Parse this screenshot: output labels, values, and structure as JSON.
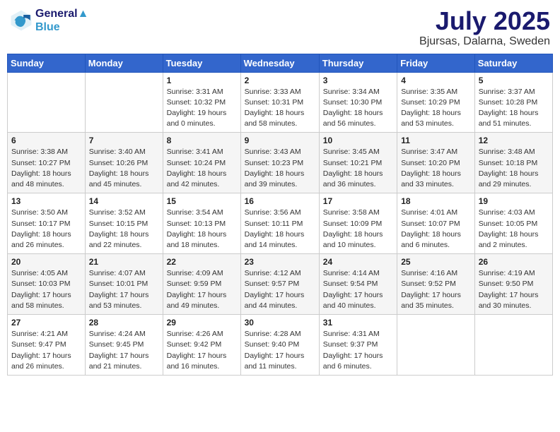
{
  "header": {
    "logo_line1": "General",
    "logo_line2": "Blue",
    "month": "July 2025",
    "location": "Bjursas, Dalarna, Sweden"
  },
  "weekdays": [
    "Sunday",
    "Monday",
    "Tuesday",
    "Wednesday",
    "Thursday",
    "Friday",
    "Saturday"
  ],
  "weeks": [
    [
      {
        "day": "",
        "content": ""
      },
      {
        "day": "",
        "content": ""
      },
      {
        "day": "1",
        "content": "Sunrise: 3:31 AM\nSunset: 10:32 PM\nDaylight: 19 hours\nand 0 minutes."
      },
      {
        "day": "2",
        "content": "Sunrise: 3:33 AM\nSunset: 10:31 PM\nDaylight: 18 hours\nand 58 minutes."
      },
      {
        "day": "3",
        "content": "Sunrise: 3:34 AM\nSunset: 10:30 PM\nDaylight: 18 hours\nand 56 minutes."
      },
      {
        "day": "4",
        "content": "Sunrise: 3:35 AM\nSunset: 10:29 PM\nDaylight: 18 hours\nand 53 minutes."
      },
      {
        "day": "5",
        "content": "Sunrise: 3:37 AM\nSunset: 10:28 PM\nDaylight: 18 hours\nand 51 minutes."
      }
    ],
    [
      {
        "day": "6",
        "content": "Sunrise: 3:38 AM\nSunset: 10:27 PM\nDaylight: 18 hours\nand 48 minutes."
      },
      {
        "day": "7",
        "content": "Sunrise: 3:40 AM\nSunset: 10:26 PM\nDaylight: 18 hours\nand 45 minutes."
      },
      {
        "day": "8",
        "content": "Sunrise: 3:41 AM\nSunset: 10:24 PM\nDaylight: 18 hours\nand 42 minutes."
      },
      {
        "day": "9",
        "content": "Sunrise: 3:43 AM\nSunset: 10:23 PM\nDaylight: 18 hours\nand 39 minutes."
      },
      {
        "day": "10",
        "content": "Sunrise: 3:45 AM\nSunset: 10:21 PM\nDaylight: 18 hours\nand 36 minutes."
      },
      {
        "day": "11",
        "content": "Sunrise: 3:47 AM\nSunset: 10:20 PM\nDaylight: 18 hours\nand 33 minutes."
      },
      {
        "day": "12",
        "content": "Sunrise: 3:48 AM\nSunset: 10:18 PM\nDaylight: 18 hours\nand 29 minutes."
      }
    ],
    [
      {
        "day": "13",
        "content": "Sunrise: 3:50 AM\nSunset: 10:17 PM\nDaylight: 18 hours\nand 26 minutes."
      },
      {
        "day": "14",
        "content": "Sunrise: 3:52 AM\nSunset: 10:15 PM\nDaylight: 18 hours\nand 22 minutes."
      },
      {
        "day": "15",
        "content": "Sunrise: 3:54 AM\nSunset: 10:13 PM\nDaylight: 18 hours\nand 18 minutes."
      },
      {
        "day": "16",
        "content": "Sunrise: 3:56 AM\nSunset: 10:11 PM\nDaylight: 18 hours\nand 14 minutes."
      },
      {
        "day": "17",
        "content": "Sunrise: 3:58 AM\nSunset: 10:09 PM\nDaylight: 18 hours\nand 10 minutes."
      },
      {
        "day": "18",
        "content": "Sunrise: 4:01 AM\nSunset: 10:07 PM\nDaylight: 18 hours\nand 6 minutes."
      },
      {
        "day": "19",
        "content": "Sunrise: 4:03 AM\nSunset: 10:05 PM\nDaylight: 18 hours\nand 2 minutes."
      }
    ],
    [
      {
        "day": "20",
        "content": "Sunrise: 4:05 AM\nSunset: 10:03 PM\nDaylight: 17 hours\nand 58 minutes."
      },
      {
        "day": "21",
        "content": "Sunrise: 4:07 AM\nSunset: 10:01 PM\nDaylight: 17 hours\nand 53 minutes."
      },
      {
        "day": "22",
        "content": "Sunrise: 4:09 AM\nSunset: 9:59 PM\nDaylight: 17 hours\nand 49 minutes."
      },
      {
        "day": "23",
        "content": "Sunrise: 4:12 AM\nSunset: 9:57 PM\nDaylight: 17 hours\nand 44 minutes."
      },
      {
        "day": "24",
        "content": "Sunrise: 4:14 AM\nSunset: 9:54 PM\nDaylight: 17 hours\nand 40 minutes."
      },
      {
        "day": "25",
        "content": "Sunrise: 4:16 AM\nSunset: 9:52 PM\nDaylight: 17 hours\nand 35 minutes."
      },
      {
        "day": "26",
        "content": "Sunrise: 4:19 AM\nSunset: 9:50 PM\nDaylight: 17 hours\nand 30 minutes."
      }
    ],
    [
      {
        "day": "27",
        "content": "Sunrise: 4:21 AM\nSunset: 9:47 PM\nDaylight: 17 hours\nand 26 minutes."
      },
      {
        "day": "28",
        "content": "Sunrise: 4:24 AM\nSunset: 9:45 PM\nDaylight: 17 hours\nand 21 minutes."
      },
      {
        "day": "29",
        "content": "Sunrise: 4:26 AM\nSunset: 9:42 PM\nDaylight: 17 hours\nand 16 minutes."
      },
      {
        "day": "30",
        "content": "Sunrise: 4:28 AM\nSunset: 9:40 PM\nDaylight: 17 hours\nand 11 minutes."
      },
      {
        "day": "31",
        "content": "Sunrise: 4:31 AM\nSunset: 9:37 PM\nDaylight: 17 hours\nand 6 minutes."
      },
      {
        "day": "",
        "content": ""
      },
      {
        "day": "",
        "content": ""
      }
    ]
  ]
}
